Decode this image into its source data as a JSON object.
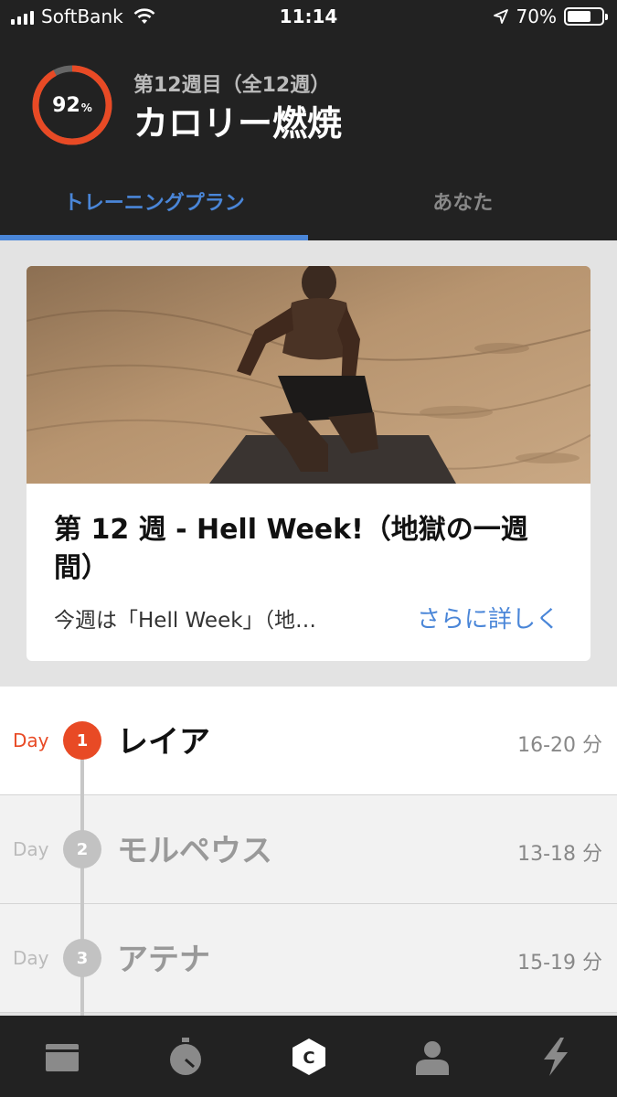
{
  "status_bar": {
    "carrier": "SoftBank",
    "time": "11:14",
    "battery_percent": "70%",
    "battery_level": 0.7
  },
  "header": {
    "progress_value": "92",
    "progress_unit": "%",
    "progress_fraction": 0.92,
    "week_label": "第12週目（全12週）",
    "plan_title": "カロリー燃焼"
  },
  "tabs": [
    {
      "label": "トレーニングプラン",
      "active": true
    },
    {
      "label": "あなた",
      "active": false
    }
  ],
  "card": {
    "title": "第 12 週 - Hell Week!（地獄の一週間）",
    "description": "今週は「Hell Week」（地…",
    "more_link": "さらに詳しく"
  },
  "days": [
    {
      "label": "Day",
      "number": "1",
      "name": "レイア",
      "duration": "16-20 分"
    },
    {
      "label": "Day",
      "number": "2",
      "name": "モルペウス",
      "duration": "13-18 分"
    },
    {
      "label": "Day",
      "number": "3",
      "name": "アテナ",
      "duration": "15-19 分"
    }
  ],
  "bottom_nav": [
    {
      "icon": "calendar-icon"
    },
    {
      "icon": "stopwatch-icon"
    },
    {
      "icon": "coach-c-icon",
      "glyph": "C"
    },
    {
      "icon": "profile-icon"
    },
    {
      "icon": "lightning-icon"
    }
  ],
  "colors": {
    "accent_blue": "#4a86d8",
    "accent_orange": "#e84a25",
    "header_bg": "#222222"
  }
}
